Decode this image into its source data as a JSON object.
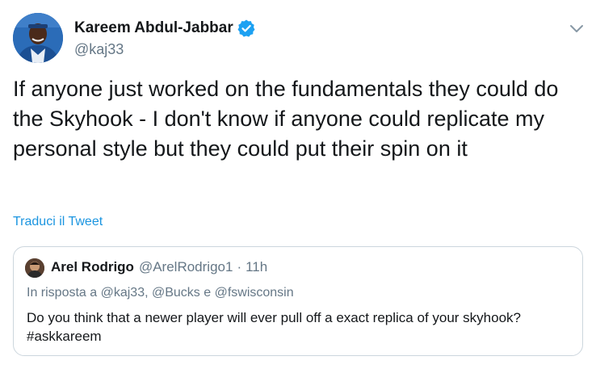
{
  "author": {
    "name": "Kareem Abdul-Jabbar",
    "handle": "@kaj33",
    "verified": true
  },
  "tweet": {
    "text": "If anyone just worked on the fundamentals they could do the Skyhook - I don't know if anyone could replicate my personal style but they could put their spin on it",
    "translate_label": "Traduci il Tweet"
  },
  "quoted_tweet": {
    "author_name": "Arel Rodrigo",
    "author_handle": "@ArelRodrigo1",
    "separator": "·",
    "time": "11h",
    "reply_context": "In risposta a @kaj33, @Bucks e @fswisconsin",
    "text": "Do you think that a newer player will ever pull off a exact replica of your skyhook? #askkareem"
  },
  "icons": {
    "verified": "verified-badge-icon",
    "menu": "chevron-down-icon"
  },
  "colors": {
    "link": "#1b95e0",
    "verified": "#1da1f2",
    "secondary_text": "#657786",
    "border": "#ccd6dd"
  }
}
